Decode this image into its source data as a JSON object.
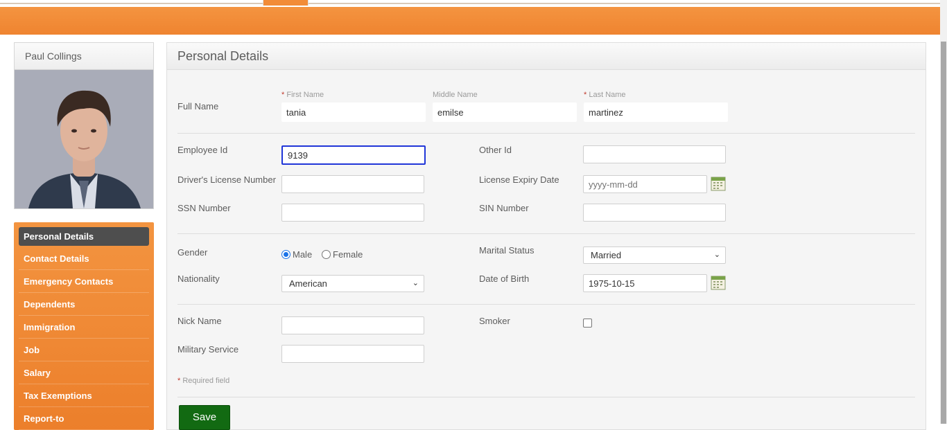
{
  "profile": {
    "name": "Paul Collings"
  },
  "sidebar": {
    "items": [
      {
        "label": "Personal Details",
        "active": true
      },
      {
        "label": "Contact Details"
      },
      {
        "label": "Emergency Contacts"
      },
      {
        "label": "Dependents"
      },
      {
        "label": "Immigration"
      },
      {
        "label": "Job"
      },
      {
        "label": "Salary"
      },
      {
        "label": "Tax Exemptions"
      },
      {
        "label": "Report-to"
      }
    ]
  },
  "panel": {
    "title": "Personal Details",
    "full_name": {
      "label": "Full Name",
      "first_label": "First Name",
      "first_value": "tania",
      "middle_label": "Middle Name",
      "middle_value": "emilse",
      "last_label": "Last Name",
      "last_value": "martinez",
      "required_mark": "*"
    },
    "employee_id": {
      "label": "Employee Id",
      "value": "9139"
    },
    "other_id": {
      "label": "Other Id",
      "value": ""
    },
    "drivers_license": {
      "label": "Driver's License Number",
      "value": ""
    },
    "license_expiry": {
      "label": "License Expiry Date",
      "placeholder": "yyyy-mm-dd"
    },
    "ssn": {
      "label": "SSN Number",
      "value": ""
    },
    "sin": {
      "label": "SIN Number",
      "value": ""
    },
    "gender": {
      "label": "Gender",
      "options": [
        "Male",
        "Female"
      ],
      "selected": "Male"
    },
    "marital_status": {
      "label": "Marital Status",
      "value": "Married"
    },
    "nationality": {
      "label": "Nationality",
      "value": "American"
    },
    "dob": {
      "label": "Date of Birth",
      "value": "1975-10-15"
    },
    "nick_name": {
      "label": "Nick Name",
      "value": ""
    },
    "smoker": {
      "label": "Smoker",
      "checked": false
    },
    "military": {
      "label": "Military Service",
      "value": ""
    },
    "required_note": "Required field",
    "save_label": "Save"
  },
  "colors": {
    "accent": "#f28c38",
    "active_nav": "#4e4e4e",
    "save": "#126a12",
    "focus": "#2036d8"
  }
}
